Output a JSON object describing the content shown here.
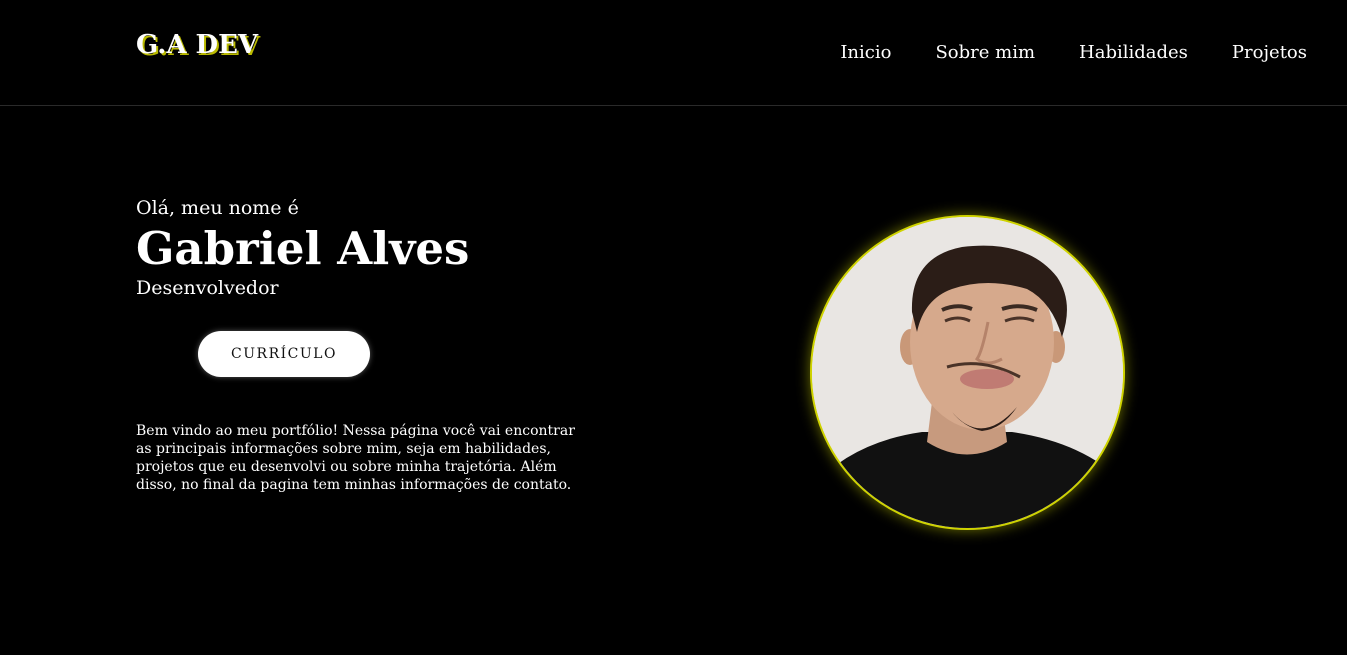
{
  "header": {
    "logo": "G.A DEV",
    "nav": [
      "Inicio",
      "Sobre mim",
      "Habilidades",
      "Projetos"
    ]
  },
  "hero": {
    "greeting": "Olá, meu nome é",
    "name": "Gabriel Alves",
    "role": "Desenvolvedor",
    "cv_button": "CURRÍCULO",
    "intro": "Bem vindo ao meu portfólio! Nessa página você vai encontrar as principais informações sobre mim, seja em habilidades, projetos que eu desenvolvi ou sobre minha trajetória. Além disso, no final da pagina tem minhas informações de contato."
  },
  "colors": {
    "background": "#000000",
    "accent": "#cfd300",
    "text": "#ffffff"
  }
}
